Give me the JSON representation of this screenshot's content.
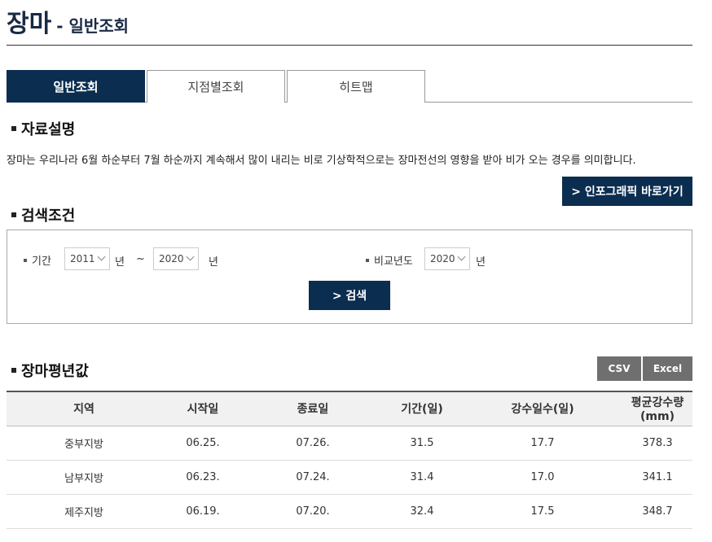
{
  "title": {
    "main": "장마",
    "sub": "- 일반조회"
  },
  "tabs": [
    {
      "label": "일반조회",
      "active": true
    },
    {
      "label": "지점별조회",
      "active": false
    },
    {
      "label": "히트맵",
      "active": false
    }
  ],
  "sections": {
    "data_desc": "자료설명",
    "search": "검색조건",
    "averages": "장마평년값"
  },
  "description": "장마는 우리나라 6월 하순부터 7월 하순까지 계속해서 많이 내리는 비로 기상학적으로는 장마전선의 영향을 받아 비가 오는 경우를 의미합니다.",
  "infographic_button": "> 인포그래픽 바로가기",
  "search": {
    "period_label": "기간",
    "start_year": "2011",
    "end_year": "2020",
    "year_unit": "년",
    "tilde": "~",
    "compare_label": "비교년도",
    "compare_year": "2020",
    "submit": "> 검색"
  },
  "export": {
    "csv": "CSV",
    "excel": "Excel"
  },
  "table": {
    "headers": [
      "지역",
      "시작일",
      "종료일",
      "기간(일)",
      "강수일수(일)",
      "평균강수량(mm)"
    ],
    "rows": [
      [
        "중부지방",
        "06.25.",
        "07.26.",
        "31.5",
        "17.7",
        "378.3"
      ],
      [
        "남부지방",
        "06.23.",
        "07.24.",
        "31.4",
        "17.0",
        "341.1"
      ],
      [
        "제주지방",
        "06.19.",
        "07.20.",
        "32.4",
        "17.5",
        "348.7"
      ]
    ]
  }
}
